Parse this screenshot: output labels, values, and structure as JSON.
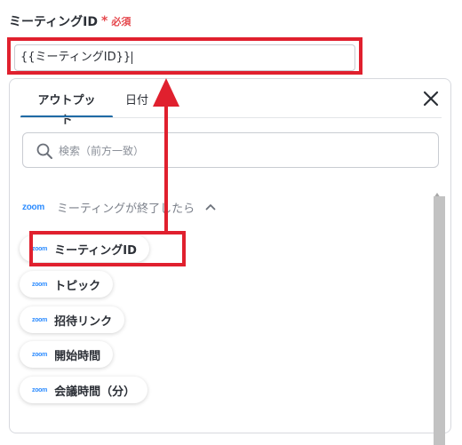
{
  "field": {
    "label": "ミーティングID",
    "required_star": "*",
    "required_text": "必須",
    "value": "{{ミーティングID}}"
  },
  "tabs": [
    {
      "label": "アウトプット",
      "active": true
    },
    {
      "label": "日付",
      "active": false
    }
  ],
  "search": {
    "placeholder": "検索（前方一致）"
  },
  "group": {
    "logo": "zoom",
    "title": "ミーティングが終了したら"
  },
  "chips": [
    {
      "logo": "zoom",
      "label": "ミーティングID"
    },
    {
      "logo": "zoom",
      "label": "トピック"
    },
    {
      "logo": "zoom",
      "label": "招待リンク"
    },
    {
      "logo": "zoom",
      "label": "開始時間"
    },
    {
      "logo": "zoom",
      "label": "会議時間（分）"
    }
  ],
  "colors": {
    "highlight": "#e0202e",
    "zoom_blue": "#2d8cff",
    "tab_underline": "#1f6aa5",
    "required": "#e5484d"
  },
  "icons": {
    "close": "close-icon",
    "search": "search-icon",
    "chevron": "chevron-up-icon",
    "scroll_up": "scroll-up-arrow-icon",
    "arrow": "up-arrow-annotation"
  }
}
